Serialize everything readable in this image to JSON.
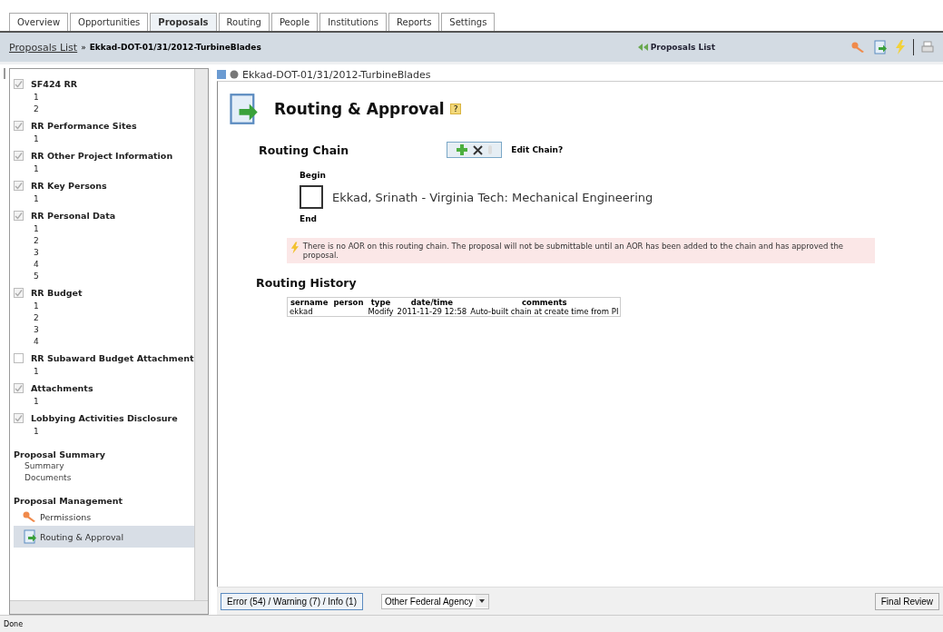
{
  "tabs": [
    {
      "label": "Overview",
      "selected": false
    },
    {
      "label": "Opportunities",
      "selected": false
    },
    {
      "label": "Proposals",
      "selected": true
    },
    {
      "label": "Routing",
      "selected": false
    },
    {
      "label": "People",
      "selected": false
    },
    {
      "label": "Institutions",
      "selected": false
    },
    {
      "label": "Reports",
      "selected": false
    },
    {
      "label": "Settings",
      "selected": false
    }
  ],
  "breadcrumb": {
    "link": "Proposals List",
    "separator": "»",
    "current": "Ekkad-DOT-01/31/2012-TurbineBlades",
    "back_link": "Proposals List"
  },
  "sidebar": {
    "forms": [
      {
        "title": "SF424 RR",
        "checked": true,
        "children": [
          {
            "label": "1"
          },
          {
            "label": "2"
          }
        ]
      },
      {
        "title": "RR Performance Sites",
        "checked": true,
        "children": [
          {
            "label": "1"
          }
        ]
      },
      {
        "title": "RR Other Project Information",
        "checked": true,
        "children": [
          {
            "label": "1"
          }
        ]
      },
      {
        "title": "RR Key Persons",
        "checked": true,
        "children": [
          {
            "label": "1"
          }
        ]
      },
      {
        "title": "RR Personal Data",
        "checked": true,
        "children": [
          {
            "label": "1"
          },
          {
            "label": "2"
          },
          {
            "label": "3"
          },
          {
            "label": "4"
          },
          {
            "label": "5"
          }
        ]
      },
      {
        "title": "RR Budget",
        "checked": true,
        "children": [
          {
            "label": "1"
          },
          {
            "label": "2"
          },
          {
            "label": "3"
          },
          {
            "label": "4"
          }
        ]
      },
      {
        "title": "RR Subaward Budget Attachment",
        "checked": false,
        "children": [
          {
            "label": "1"
          }
        ]
      },
      {
        "title": "Attachments",
        "checked": true,
        "children": [
          {
            "label": "1"
          }
        ]
      },
      {
        "title": "Lobbying Activities Disclosure",
        "checked": true,
        "children": [
          {
            "label": "1"
          }
        ]
      }
    ],
    "summary": {
      "heading": "Proposal Summary",
      "items": [
        {
          "label": "Summary"
        },
        {
          "label": "Documents"
        }
      ]
    },
    "management": {
      "heading": "Proposal Management",
      "items": [
        {
          "label": "Permissions",
          "kind": "key",
          "selected": false
        },
        {
          "label": "Routing & Approval",
          "kind": "routing",
          "selected": true
        }
      ]
    }
  },
  "document": {
    "title": "Ekkad-DOT-01/31/2012-TurbineBlades"
  },
  "page": {
    "title": "Routing & Approval",
    "help": "?",
    "chain": {
      "heading": "Routing Chain",
      "edit_label": "Edit Chain?",
      "begin": "Begin",
      "end": "End",
      "members": [
        {
          "label": "Ekkad, Srinath - Virginia Tech: Mechanical Engineering",
          "checked": false
        }
      ]
    },
    "warning": "There is no AOR on this routing chain. The proposal will not be submittable until an AOR has been added to the chain and has approved the proposal.",
    "history": {
      "heading": "Routing History",
      "columns": [
        "sername",
        "person",
        "type",
        "date/time",
        "comments"
      ],
      "rows": [
        [
          "ekkad",
          "",
          "Modify",
          "2011-11-29 12:58",
          "Auto-built chain at create time from PI"
        ]
      ]
    }
  },
  "footer": {
    "messages": "Error (54) / Warning (7) / Info (1)",
    "agency": "Other Federal Agency",
    "final": "Final Review"
  },
  "status_bar": "Done"
}
